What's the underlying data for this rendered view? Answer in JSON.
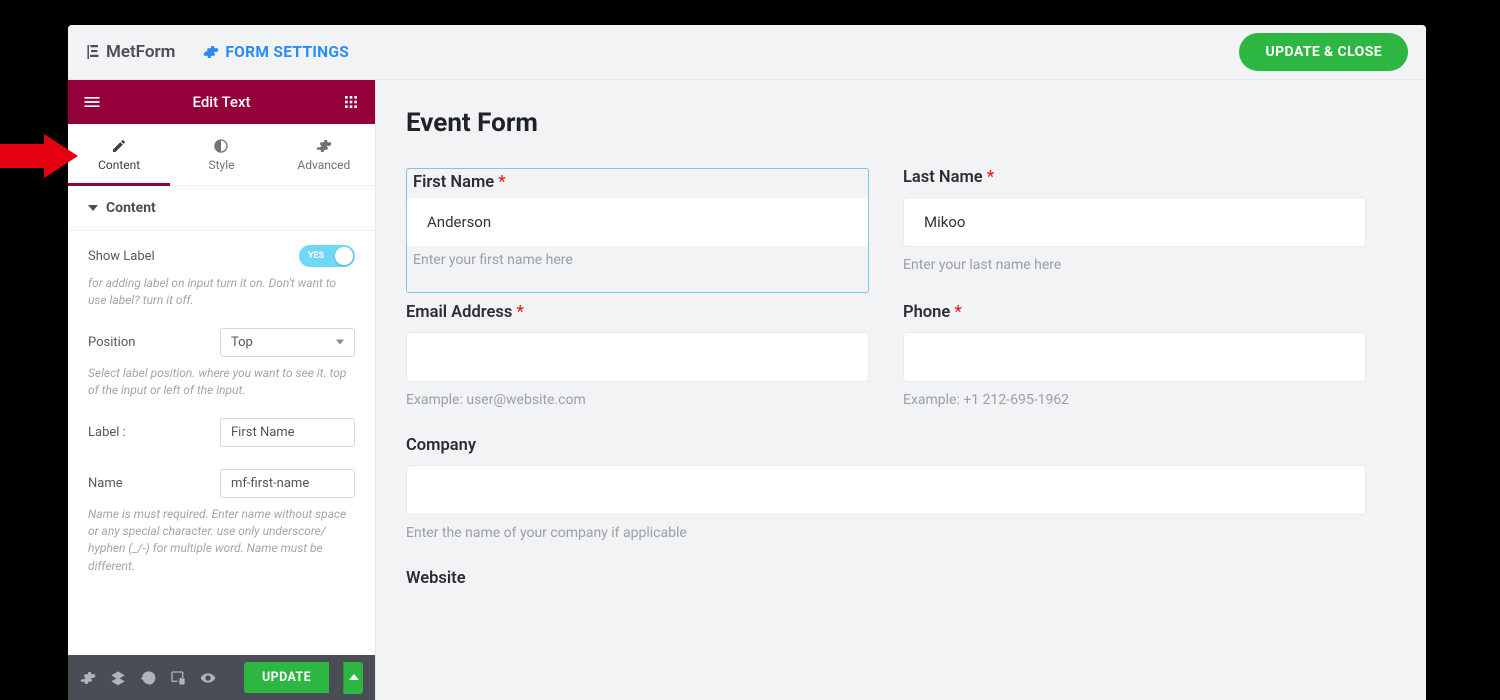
{
  "topbar": {
    "brand": "MetForm",
    "form_settings": "FORM SETTINGS",
    "update_close": "UPDATE & CLOSE"
  },
  "panel": {
    "header_title": "Edit Text",
    "tabs": {
      "content": "Content",
      "style": "Style",
      "advanced": "Advanced"
    },
    "section_title": "Content",
    "show_label": {
      "label": "Show Label",
      "state": "YES",
      "hint": "for adding label on input turn it on. Don't want to use label? turn it off."
    },
    "position": {
      "label": "Position",
      "value": "Top",
      "hint": "Select label position. where you want to see it. top of the input or left of the input."
    },
    "label_field": {
      "label": "Label :",
      "value": "First Name"
    },
    "name_field": {
      "label": "Name",
      "value": "mf-first-name",
      "hint": "Name is must required. Enter name without space or any special character. use only underscore/ hyphen (_/-) for multiple word. Name must be different."
    }
  },
  "bottombar": {
    "update": "UPDATE"
  },
  "form": {
    "title": "Event Form",
    "first_name": {
      "label": "First Name",
      "value": "Anderson",
      "hint": "Enter your first name here"
    },
    "last_name": {
      "label": "Last Name",
      "value": "Mikoo",
      "hint": "Enter your last name here"
    },
    "email": {
      "label": "Email Address",
      "hint": "Example: user@website.com"
    },
    "phone": {
      "label": "Phone",
      "hint": "Example: +1 212-695-1962"
    },
    "company": {
      "label": "Company",
      "hint": "Enter the name of your company if applicable"
    },
    "website": {
      "label": "Website"
    }
  }
}
